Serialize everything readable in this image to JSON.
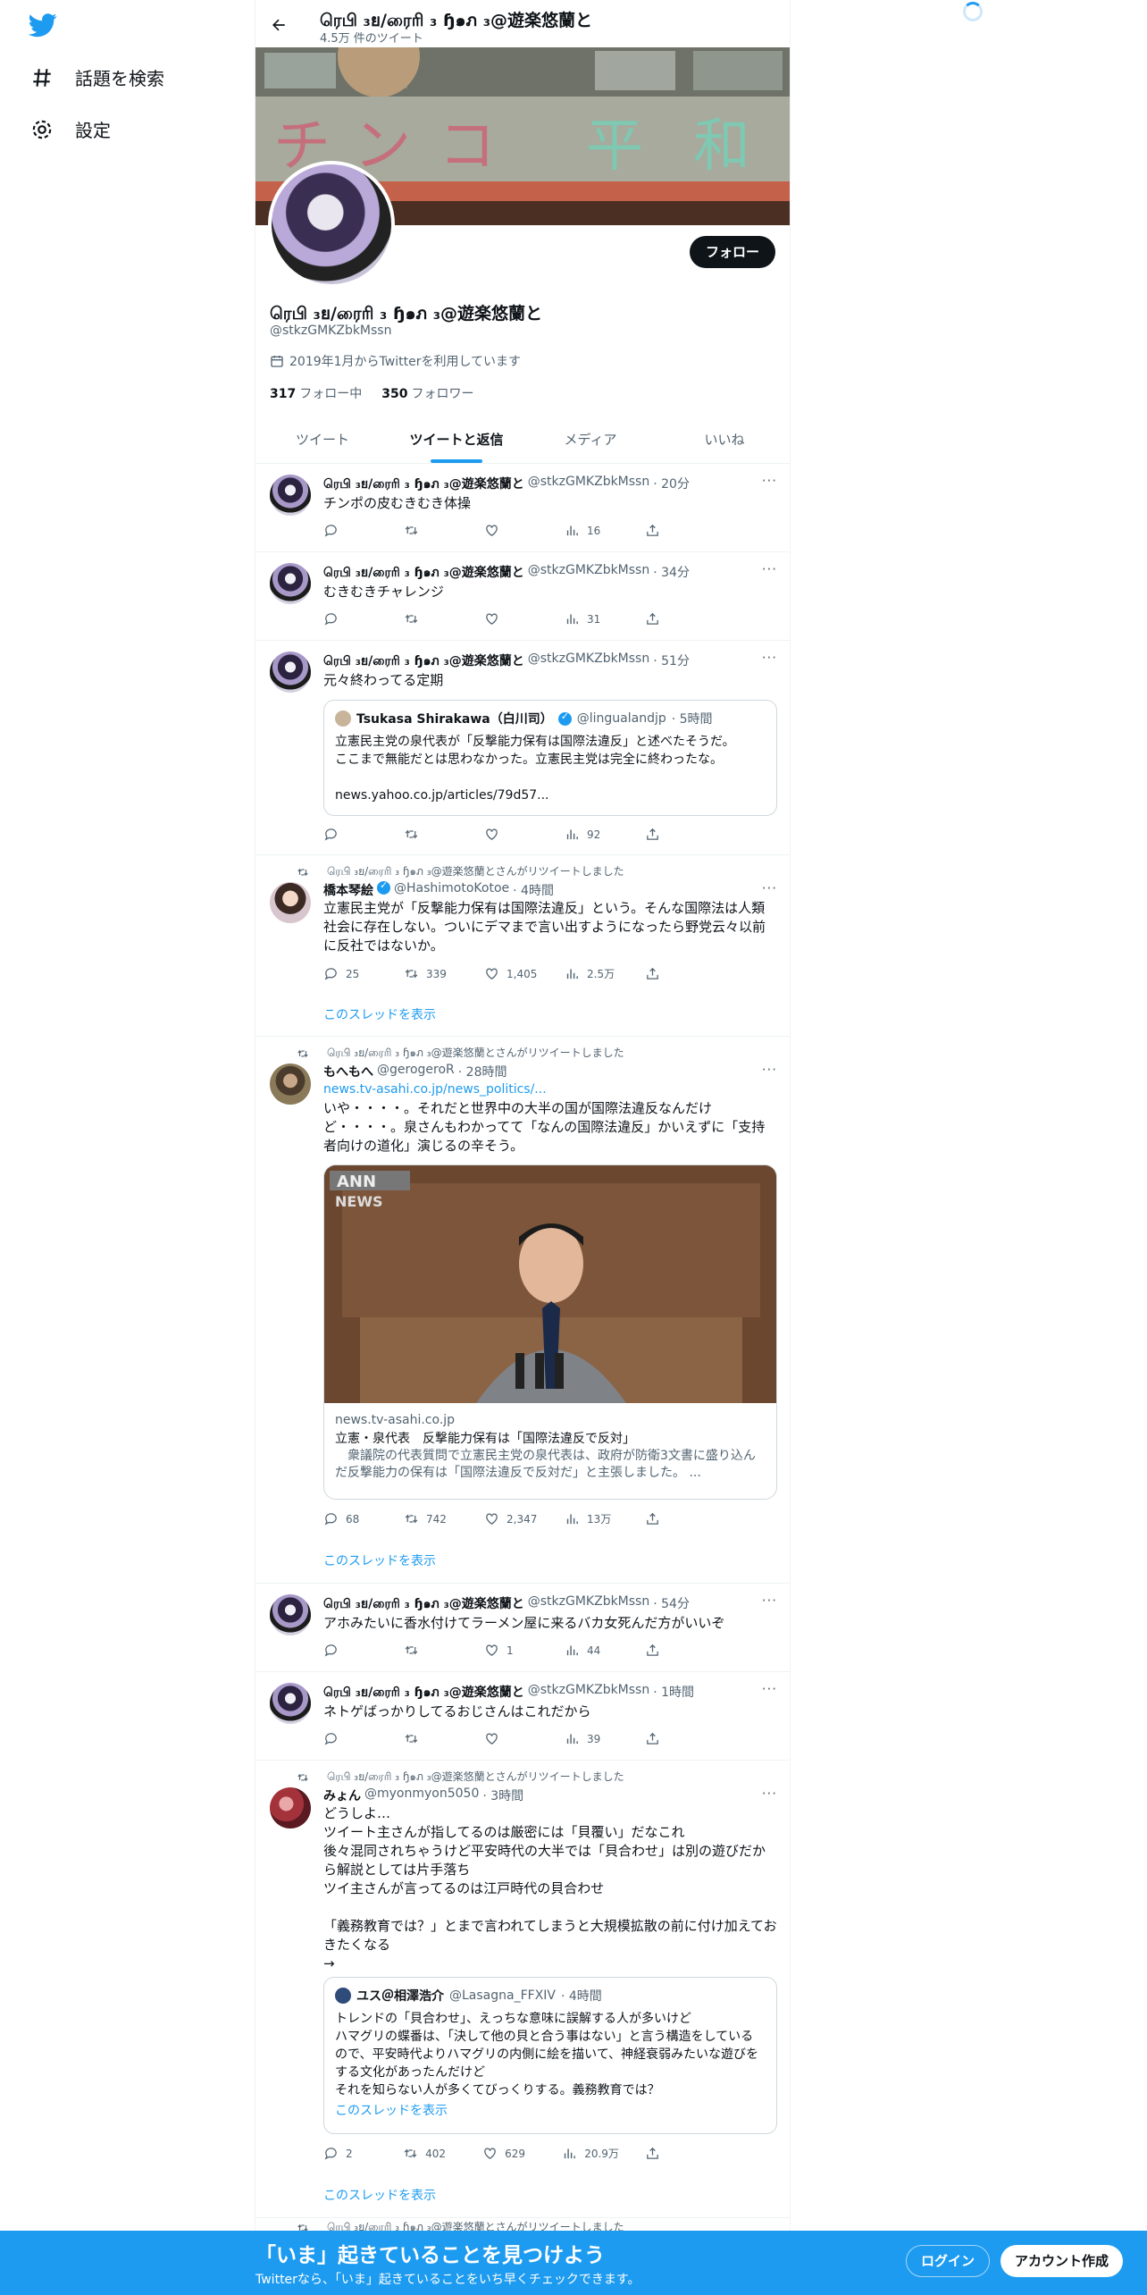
{
  "nav": {
    "explore_label": "話題を検索",
    "settings_label": "設定"
  },
  "header": {
    "name": "ரெபி ₃ย/ரைரி ₃ ɧ๑ภ ₃@遊楽悠蘭と",
    "tweet_count": "4.5万 件のツイート"
  },
  "banner": {
    "sign_chars": [
      "チ",
      "ン",
      "コ",
      "平",
      "和"
    ]
  },
  "profile": {
    "follow_label": "フォロー",
    "name": "ரெபி ₃ย/ரைரி ₃ ɧ๑ภ ₃@遊楽悠蘭と",
    "handle": "@stkzGMKZbkMssn",
    "joined": "2019年1月からTwitterを利用しています",
    "following_count": "317",
    "following_label": "フォロー中",
    "followers_count": "350",
    "followers_label": "フォロワー"
  },
  "tabs": [
    "ツイート",
    "ツイートと返信",
    "メディア",
    "いいね"
  ],
  "self": {
    "name": "ரெபி ₃ย/ரைரி ₃ ɧ๑ภ ₃@遊楽悠蘭と",
    "handle": "@stkzGMKZbkMssn"
  },
  "retweet_label": "ரெபி ₃ย/ரைரி ₃ ɧ๑ภ ₃@遊楽悠蘭とさんがリツイートしました",
  "thread_link": "このスレッドを表示",
  "tweets": [
    {
      "time": "· 20分",
      "text": "チンポの皮むきむき体操",
      "views": "16"
    },
    {
      "time": "· 34分",
      "text": "むきむきチャレンジ",
      "views": "31"
    },
    {
      "time": "· 51分",
      "text": "元々終わってる定期",
      "views": "92",
      "quote": {
        "name": "Tsukasa Shirakawa（白川司）",
        "handle": "@lingualandjp",
        "time": "· 5時間",
        "text": "立憲民主党の泉代表が「反撃能力保有は国際法違反」と述べたそうだ。\nここまで無能だとは思わなかった。立憲民主党は完全に終わったな。\n\nnews.yahoo.co.jp/articles/79d57..."
      }
    },
    {
      "name": "橋本琴絵",
      "handle": "@HashimotoKotoe",
      "time": "· 4時間",
      "text": "立憲民主党が「反撃能力保有は国際法違反」という。そんな国際法は人類社会に存在しない。ついにデマまで言い出すようになったら野党云々以前に反社ではないか。",
      "replies": "25",
      "retweets": "339",
      "likes": "1,405",
      "views": "2.5万"
    },
    {
      "name": "もへもへ",
      "handle": "@gerogeroR",
      "time": "· 28時間",
      "link": "news.tv-asahi.co.jp/news_politics/...",
      "text": "いや・・・・。それだと世界中の大半の国が国際法違反なんだけど・・・・。泉さんもわかってて「なんの国際法違反」かいえずに「支持者向けの道化」演じるの辛そう。",
      "card": {
        "badge_top": "ANN",
        "badge_bottom": "NEWS",
        "domain": "news.tv-asahi.co.jp",
        "title": "立憲・泉代表　反撃能力保有は「国際法違反で反対」",
        "desc": "　衆議院の代表質問で立憲民主党の泉代表は、政府が防衛3文書に盛り込んだ反撃能力の保有は「国際法違反で反対だ」と主張しました。 ..."
      },
      "replies": "68",
      "retweets": "742",
      "likes": "2,347",
      "views": "13万"
    },
    {
      "time": "· 54分",
      "text": "アホみたいに香水付けてラーメン屋に来るバカ女死んだ方がいいぞ",
      "likes": "1",
      "views": "44"
    },
    {
      "time": "· 1時間",
      "text": "ネトゲばっかりしてるおじさんはこれだから",
      "views": "39"
    },
    {
      "name": "みょん",
      "handle": "@myonmyon5050",
      "time": "· 3時間",
      "text": "どうしよ…\nツイート主さんが指してるのは厳密には「貝覆い」だなこれ\n後々混同されちゃうけど平安時代の大半では「貝合わせ」は別の遊びだから解説としては片手落ち\nツイ主さんが言ってるのは江戸時代の貝合わせ\n\n「義務教育では？」とまで言われてしまうと大規模拡散の前に付け加えておきたくなる\n→",
      "quote": {
        "name": "ユス＠相澤浩介",
        "handle": "@Lasagna_FFXIV",
        "time": "· 4時間",
        "text": "トレンドの「貝合わせ」、えっちな意味に誤解する人が多いけど\nハマグリの蝶番は、「決して他の貝と合う事はない」と言う構造をしているので、平安時代よりハマグリの内側に絵を描いて、神経衰弱みたいな遊びをする文化があったんだけど\nそれを知らない人が多くてびっくりする。義務教育では？"
      },
      "replies": "2",
      "retweets": "402",
      "likes": "629",
      "views": "20.9万"
    }
  ],
  "footer": {
    "title": "「いま」起きていることを見つけよう",
    "subtitle": "Twitterなら、「いま」起きていることをいち早くチェックできます。",
    "login_label": "ログイン",
    "signup_label": "アカウント作成"
  }
}
